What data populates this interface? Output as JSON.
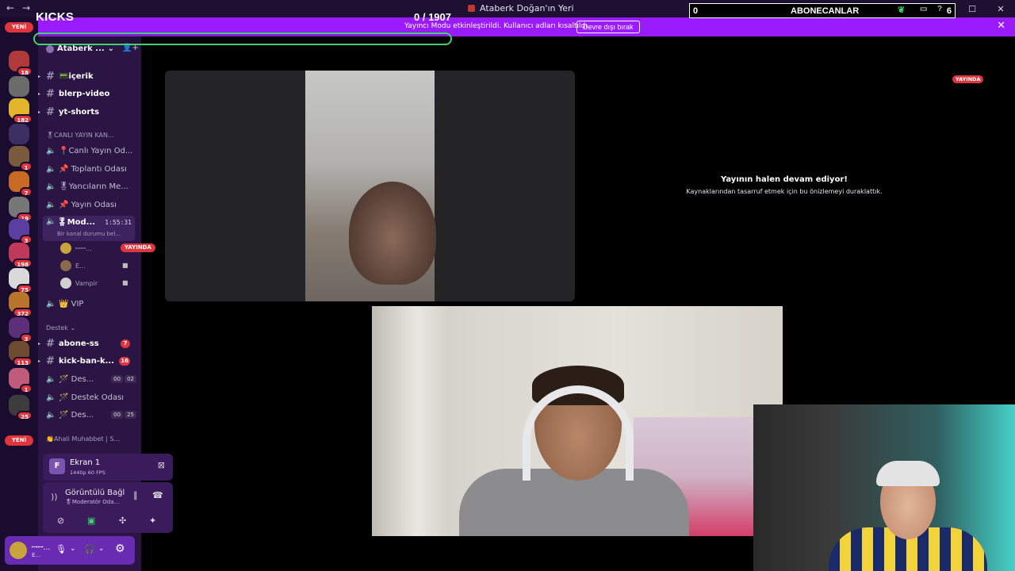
{
  "window": {
    "title": "Ataberk Doğan'ın Yeri",
    "nav_back": "←",
    "nav_forward": "→",
    "controls": {
      "minimize": "—",
      "maximize": "☐",
      "close": "✕"
    }
  },
  "overlay": {
    "kicks_label": "KICKS",
    "kicks_count": "0 / 1907",
    "kicks_progress": 0,
    "subscriber_goal": {
      "left": "0",
      "title": "ABONECANLAR",
      "right": "6"
    }
  },
  "notice": {
    "text": "Yayıncı Modu etkinleştirildi. Kullanıcı adları kısaltıldı.",
    "button": "Devre dışı bırak",
    "close": "✕"
  },
  "rail": {
    "new_label": "YENİ",
    "badges": [
      "18",
      "182",
      "1",
      "7",
      "19",
      "3",
      "198",
      "75",
      "372",
      "3",
      "113",
      "1",
      "25"
    ],
    "colors": [
      "#b03a3a",
      "#6b6b6b",
      "#e2b52b",
      "#3a2f60",
      "#7a5a3c",
      "#c76a24",
      "#777777",
      "#5a3fa0",
      "#c0395a",
      "#d9d9d9",
      "#b8742a",
      "#5b2f7a",
      "#6e4a2e",
      "#c05b7a",
      "#3c3c3c"
    ]
  },
  "sidebar": {
    "server_name": "Ataberk ...",
    "channels": [
      {
        "icon": "#",
        "label": "📟içerik"
      },
      {
        "icon": "#",
        "label": "blerp-video"
      },
      {
        "icon": "#",
        "label": "yt-shorts"
      }
    ],
    "category_live": "🎖CANLI YAYIN KAN...",
    "voice": [
      {
        "label": "📍Canlı Yayın Od..."
      },
      {
        "label": "📌 Toplantı Odası"
      },
      {
        "label": "🎖Yancıların Me..."
      },
      {
        "label": "📌 Yayın Odası"
      }
    ],
    "active_channel": {
      "label": "🎖Mod...",
      "time": "1:55:31",
      "status": "Bir kanal durumu bel..."
    },
    "members": [
      {
        "name": "ꟷꟷ...",
        "live": "YAYINDA"
      },
      {
        "name": "E..."
      },
      {
        "name": "Vampir"
      }
    ],
    "vip": "👑 VIP",
    "category_destek": "Destek",
    "destek_channels": [
      {
        "icon": "#",
        "label": "abone-ss",
        "count": "7"
      },
      {
        "icon": "#",
        "label": "kick-ban-k...",
        "count": "16"
      },
      {
        "icon": "spk",
        "label": "🪄 Des...",
        "pair": [
          "00",
          "02"
        ]
      },
      {
        "icon": "spk",
        "label": "🪄 Destek Odası"
      },
      {
        "icon": "spk",
        "label": "🪄 Des...",
        "pair": [
          "00",
          "25"
        ]
      }
    ],
    "category_ahali": "👏Ahali Muhabbet | S..."
  },
  "screen_share": {
    "title": "Ekran 1",
    "sub": "1440p 60 FPS"
  },
  "voice_status": {
    "title": "Görüntülü Bağl",
    "sub": "🎖Moderatör Oda..."
  },
  "user_panel": {
    "name": "ꟷꟷ...",
    "status": "E..."
  },
  "stage": {
    "live_pill": "YAYINDA",
    "paused_title": "Yayının halen devam ediyor!",
    "paused_sub": "Kaynaklarından tasarruf etmek için bu önizlemeyi duraklattık."
  }
}
